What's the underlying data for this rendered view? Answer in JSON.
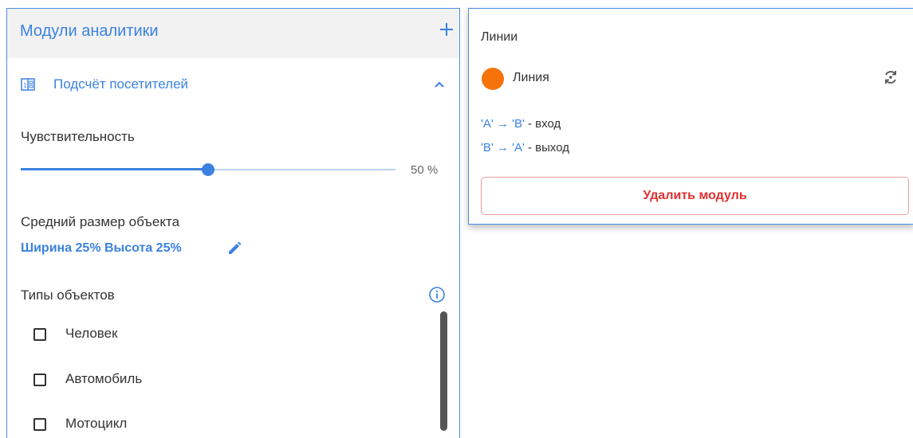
{
  "panel": {
    "title": "Модули аналитики",
    "section_title": "Подсчёт посетителей",
    "sensitivity_label": "Чувствительность",
    "sensitivity_value": 50,
    "sensitivity_text": "50 %",
    "avg_size_label": "Средний размер объекта",
    "avg_size_value": "Ширина 25% Высота 25%",
    "object_types_label": "Типы объектов",
    "object_types": [
      {
        "label": "Человек",
        "checked": false
      },
      {
        "label": "Автомобиль",
        "checked": false
      },
      {
        "label": "Мотоцикл",
        "checked": false
      }
    ]
  },
  "lines_panel": {
    "title": "Линии",
    "line_name": "Линия",
    "line_color": "#f5730a",
    "directions": [
      {
        "from": "'A'",
        "arrow": "→",
        "to": "'B'",
        "text": " - вход"
      },
      {
        "from": "'B'",
        "arrow": "→",
        "to": "'A'",
        "text": " - выход"
      }
    ],
    "delete_label": "Удалить модуль"
  },
  "colors": {
    "accent": "#3b82e0",
    "danger": "#e03030"
  },
  "icons": [
    "plus-icon",
    "counter-icon",
    "chevron-up-icon",
    "pencil-icon",
    "info-icon",
    "swap-icon"
  ]
}
